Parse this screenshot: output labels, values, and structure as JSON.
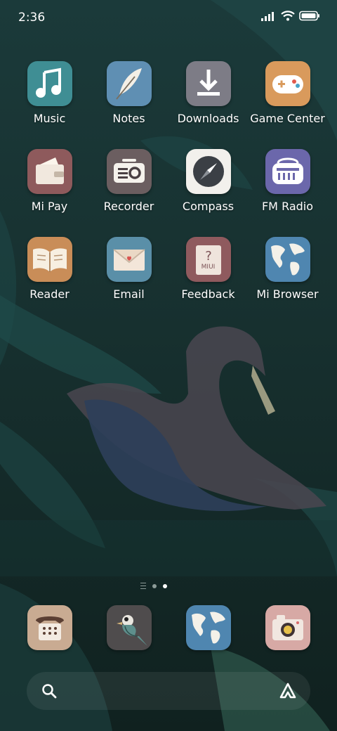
{
  "status_bar": {
    "time": "2:36"
  },
  "apps": [
    {
      "label": "Music"
    },
    {
      "label": "Notes"
    },
    {
      "label": "Downloads"
    },
    {
      "label": "Game Center"
    },
    {
      "label": "Mi Pay"
    },
    {
      "label": "Recorder"
    },
    {
      "label": "Compass"
    },
    {
      "label": "FM Radio"
    },
    {
      "label": "Reader"
    },
    {
      "label": "Email"
    },
    {
      "label": "Feedback",
      "icon_text": "MIUI"
    },
    {
      "label": "Mi Browser"
    }
  ],
  "page_indicator": {
    "pages": 2,
    "current": 2
  },
  "dock": {
    "items": [
      {
        "icon": "phone-icon"
      },
      {
        "icon": "bird-icon"
      },
      {
        "icon": "globe-icon"
      },
      {
        "icon": "camera-icon"
      }
    ]
  },
  "search_bar": {
    "left_icon": "search-icon",
    "right_icon": "assistant-icon"
  }
}
